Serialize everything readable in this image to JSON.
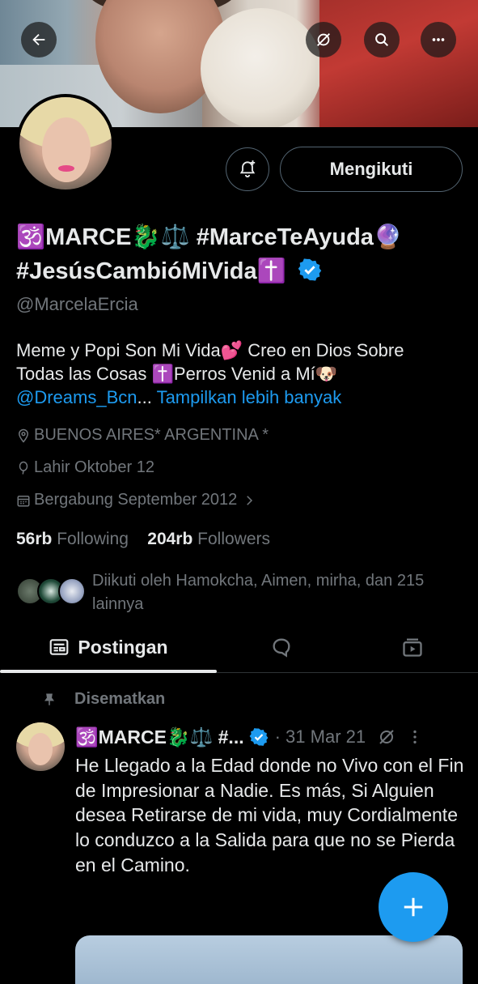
{
  "header": {
    "back_icon": "arrow-left-icon",
    "icons": [
      "grok-icon",
      "search-icon",
      "more-icon"
    ]
  },
  "profile": {
    "follow_label": "Mengikuti",
    "name_line1": "🕉️MARCE🐉⚖️ #MarceTeAyuda🔮",
    "name_line2": "#JesúsCambióMiVida✝️",
    "handle": "@MarcelaErcia",
    "bio_line1": "Meme y Popi Son Mi Vida💕 Creo en Dios Sobre",
    "bio_line2": "Todas las Cosas ✝️Perros Venid a Mí🐶",
    "bio_mention": "@Dreams_Bcn",
    "bio_ellipsis": "...",
    "show_more": "Tampilkan lebih banyak",
    "location": "BUENOS AIRES* ARGENTINA *",
    "birthday": "Lahir Oktober 12",
    "joined": "Bergabung September 2012",
    "following_count": "56rb",
    "following_label": "Following",
    "followers_count": "204rb",
    "followers_label": "Followers",
    "followed_by": "Diikuti oleh Hamokcha, Aimen, mirha, dan 215 lainnya",
    "verified_color": "#1d9bf0"
  },
  "tabs": {
    "posts_label": "Postingan",
    "active": "posts"
  },
  "tweet": {
    "pinned_label": "Disematkan",
    "author": "🕉️MARCE🐉⚖️ #...",
    "date": "· 31 Mar 21",
    "text": "He Llegado a la Edad donde no Vivo con el Fin de Impresionar a Nadie. Es más, Si Alguien desea Retirarse de mi vida, muy Cordialmente lo conduzco a la Salida para que no se Pierda en el Camino."
  },
  "colors": {
    "accent": "#1d9bf0",
    "background": "#000000",
    "muted": "#71767b"
  }
}
